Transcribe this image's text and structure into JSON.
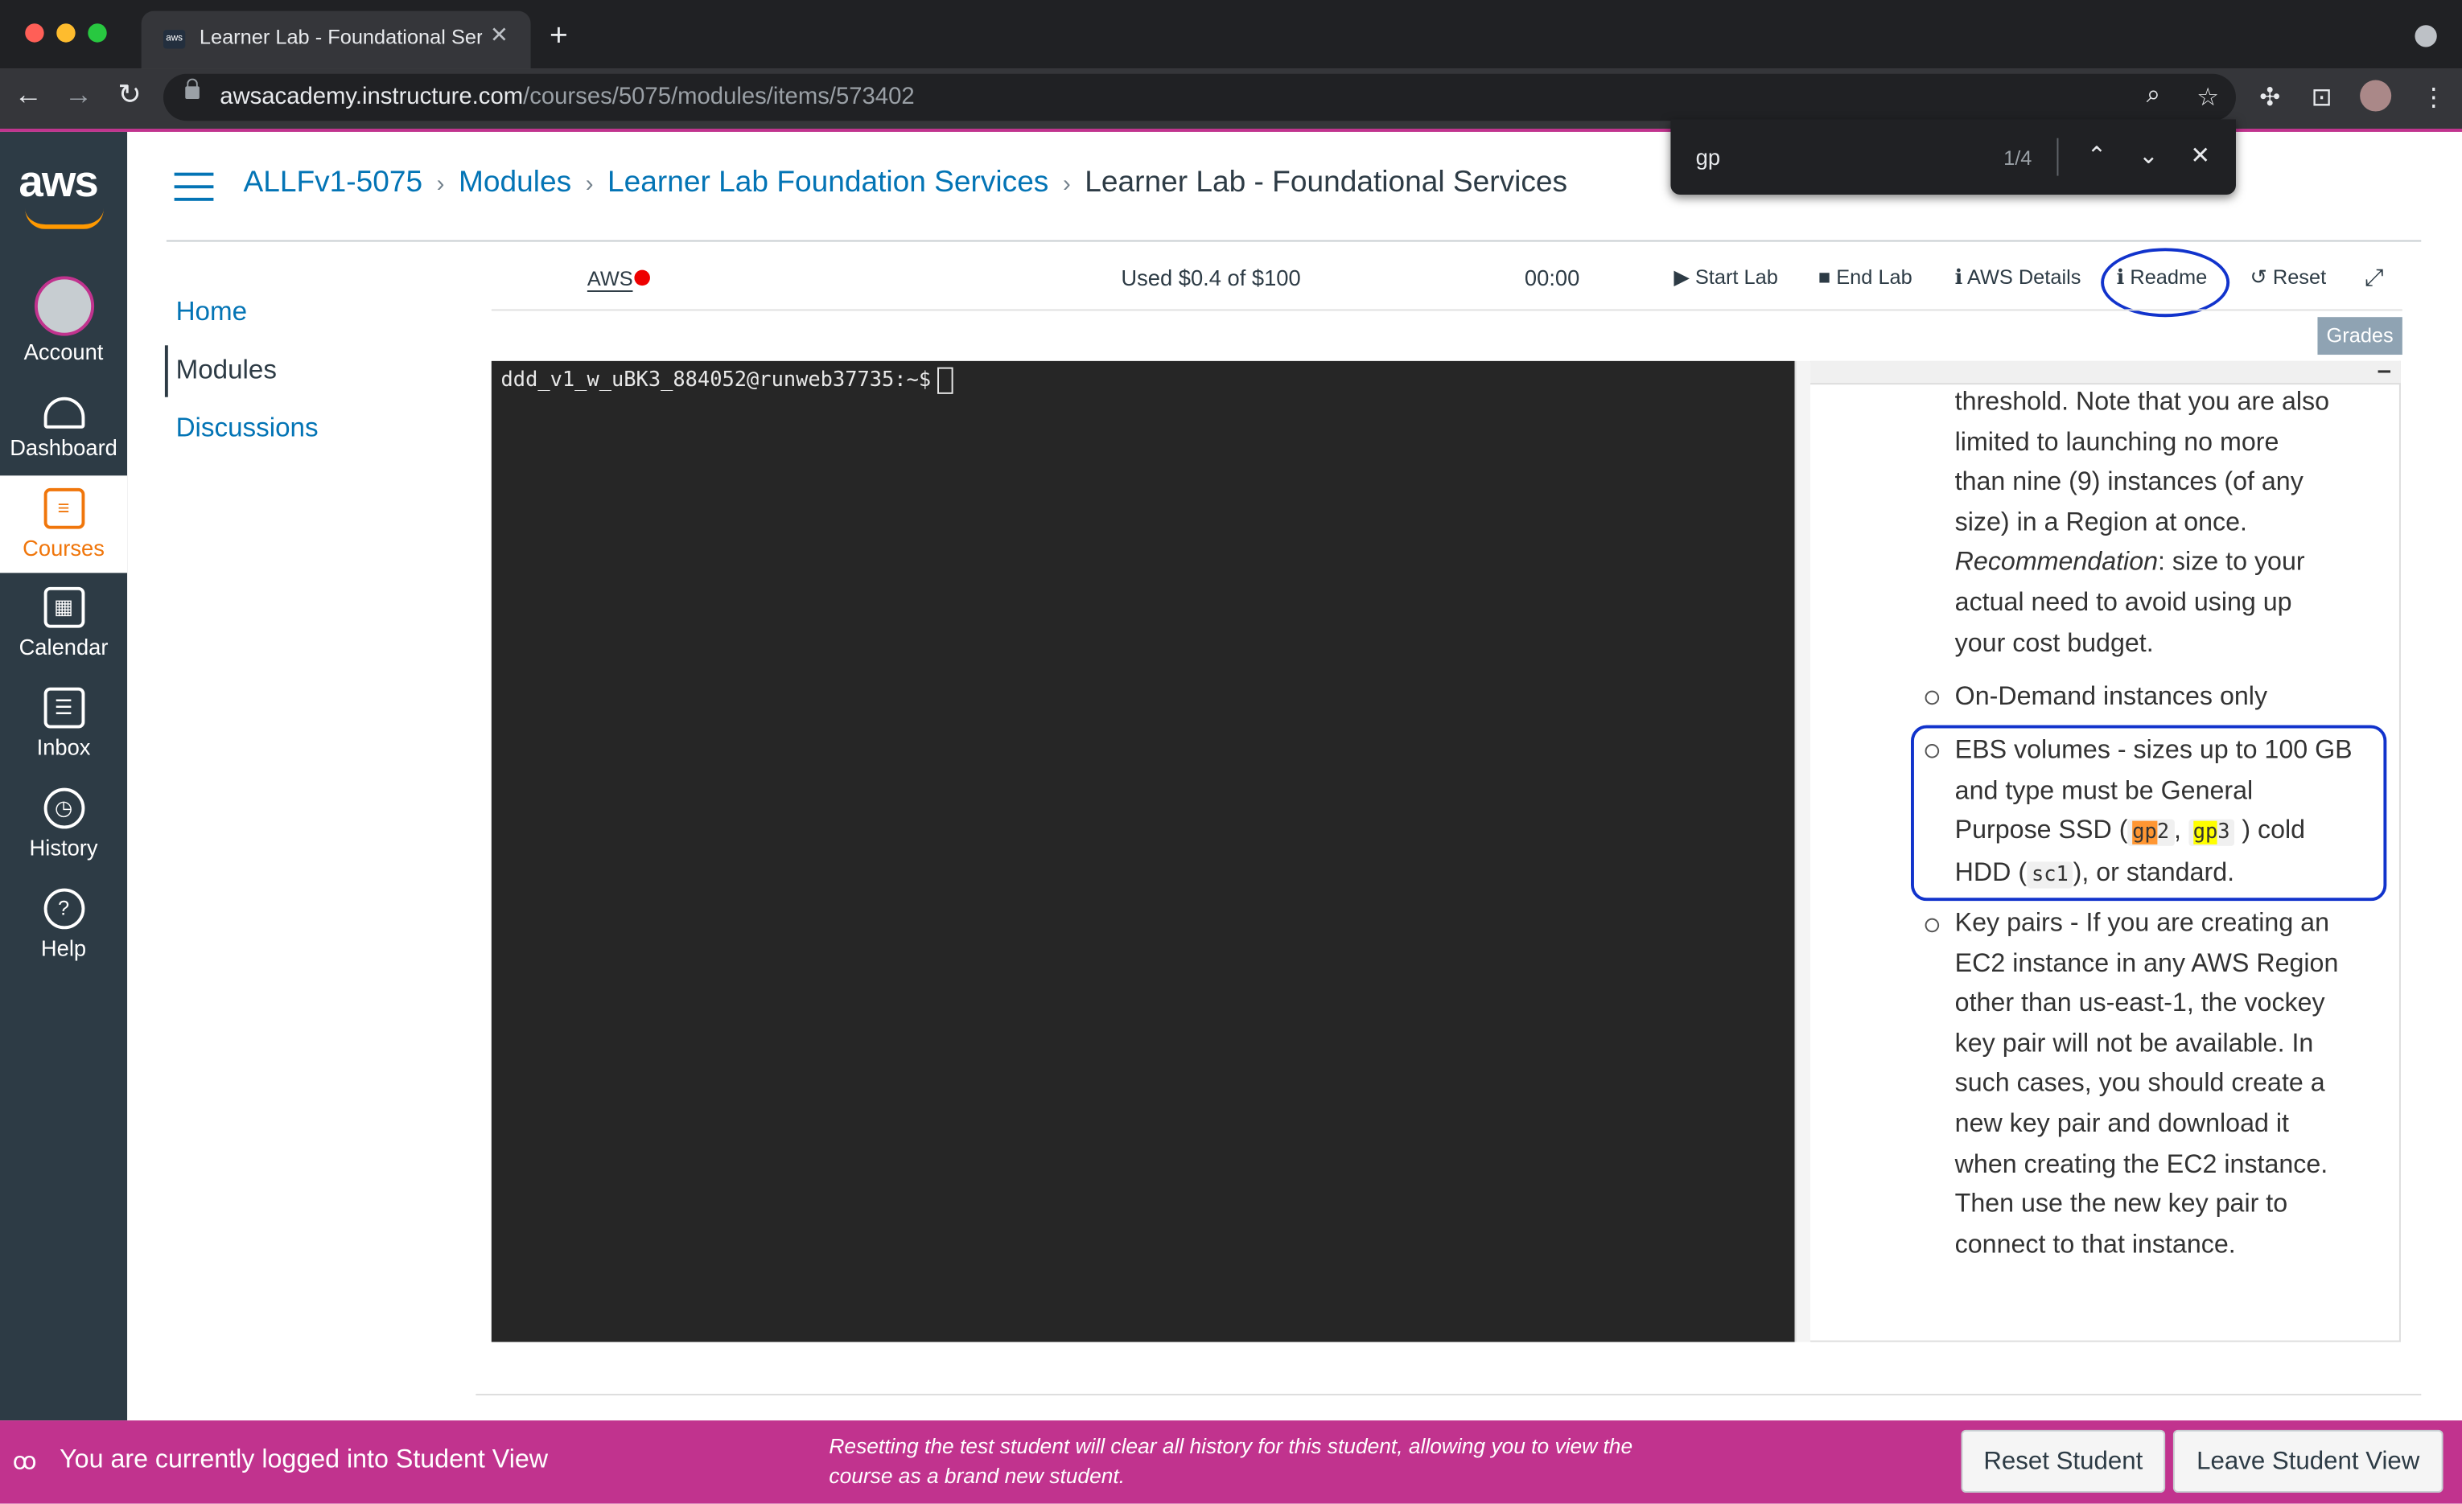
{
  "browser": {
    "tab_title": "Learner Lab - Foundational Services",
    "tab_favicon": "aws",
    "url_host": "awsacademy.instructure.com",
    "url_path": "/courses/5075/modules/items/573402",
    "find": {
      "query": "gp",
      "count": "1/4"
    }
  },
  "global_nav": {
    "logo": "aws",
    "items": [
      {
        "label": "Account",
        "icon": "avatar-icon"
      },
      {
        "label": "Dashboard",
        "icon": "dashboard-icon"
      },
      {
        "label": "Courses",
        "icon": "courses-icon",
        "active": true
      },
      {
        "label": "Calendar",
        "icon": "calendar-icon"
      },
      {
        "label": "Inbox",
        "icon": "inbox-icon"
      },
      {
        "label": "History",
        "icon": "history-icon"
      },
      {
        "label": "Help",
        "icon": "help-icon"
      }
    ]
  },
  "breadcrumb": [
    "ALLFv1-5075",
    "Modules",
    "Learner Lab Foundation Services",
    "Learner Lab - Foundational Services"
  ],
  "course_nav": [
    "Home",
    "Modules",
    "Discussions"
  ],
  "lab_toolbar": {
    "aws_label": "AWS",
    "status_color": "#e00000",
    "budget": "Used $0.4 of $100",
    "timer": "00:00",
    "start": "Start Lab",
    "end": "End Lab",
    "details": "AWS Details",
    "readme": "Readme",
    "reset": "Reset",
    "grades": "Grades"
  },
  "terminal": {
    "prompt": "ddd_v1_w_uBK3_884052@runweb37735:~$"
  },
  "readme": {
    "para1_lines": [
      "threshold. Note that you are also",
      "limited to launching no more",
      "than nine (9) instances (of any",
      "size) in a Region at once."
    ],
    "rec_label": "Recommendation",
    "rec_text": ": size to your",
    "rec_lines": [
      "actual need to avoid using up",
      "your cost budget."
    ],
    "bullet_ondemand": "On-Demand instances only",
    "ebs_line1": "EBS volumes - sizes up to 100 GB",
    "ebs_line2": "and type must be General",
    "ebs_purpose": "Purpose SSD (",
    "gp2_hl": "gp",
    "gp2_rest": "2",
    "gp3_hl": "gp",
    "gp3_rest": "3",
    "ebs_cold": " ) cold",
    "ebs_hdd": "HDD (",
    "sc1": "sc1",
    "ebs_end": "), or standard.",
    "key_lines": [
      "Key pairs - If you are creating an",
      "EC2 instance in any AWS Region",
      "other than us-east-1, the vockey",
      "key pair will not be available. In",
      "such cases, you should create a",
      "new key pair and download it",
      "when creating the EC2 instance.",
      "Then use the new key pair to",
      "connect to that instance."
    ]
  },
  "student_view": {
    "label": "You are currently logged into Student View",
    "note": "Resetting the test student will clear all history for this student, allowing you to view the course as a brand new student.",
    "reset_btn": "Reset Student",
    "leave_btn": "Leave Student View"
  },
  "colors": {
    "accent": "#0374b5",
    "nav_bg": "#2d3b45",
    "student_bar": "#c1338e",
    "active_nav": "#f0760b"
  }
}
